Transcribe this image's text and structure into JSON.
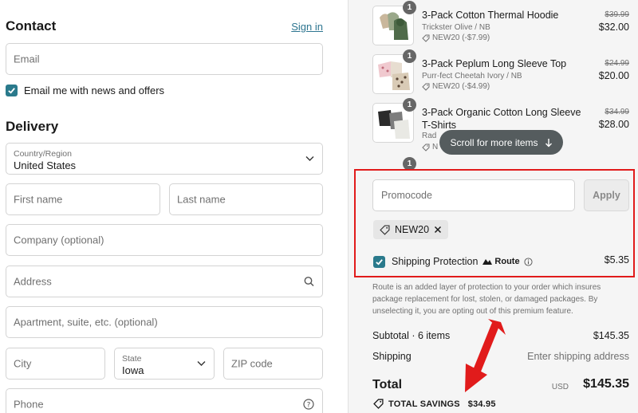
{
  "contact": {
    "title": "Contact",
    "sign_in": "Sign in",
    "email_placeholder": "Email",
    "newsletter_label": "Email me with news and offers"
  },
  "delivery": {
    "title": "Delivery",
    "country_label": "Country/Region",
    "country_value": "United States",
    "first_name_placeholder": "First name",
    "last_name_placeholder": "Last name",
    "company_placeholder": "Company (optional)",
    "address_placeholder": "Address",
    "apartment_placeholder": "Apartment, suite, etc. (optional)",
    "city_placeholder": "City",
    "state_label": "State",
    "state_value": "Iowa",
    "zip_placeholder": "ZIP code",
    "phone_placeholder": "Phone"
  },
  "cart": {
    "items": [
      {
        "quantity": "1",
        "name": "3-Pack Cotton Thermal Hoodie",
        "variant": "Trickster Olive / NB",
        "discount": "NEW20 (-$7.99)",
        "original_price": "$39.99",
        "price": "$32.00"
      },
      {
        "quantity": "1",
        "name": "3-Pack Peplum Long Sleeve Top",
        "variant": "Purr-fect Cheetah Ivory / NB",
        "discount": "NEW20 (-$4.99)",
        "original_price": "$24.99",
        "price": "$20.00"
      },
      {
        "quantity": "1",
        "name": "3-Pack Organic Cotton Long Sleeve T-Shirts",
        "variant": "Rad",
        "discount": "N",
        "original_price": "$34.99",
        "price": "$28.00"
      },
      {
        "quantity": "1"
      }
    ],
    "scroll_hint": "Scroll for more items"
  },
  "promo": {
    "placeholder": "Promocode",
    "apply_label": "Apply",
    "applied_code": "NEW20"
  },
  "shipping_protection": {
    "label": "Shipping Protection",
    "brand": "Route",
    "price": "$5.35",
    "note": "Route is an added layer of protection to your order which insures package replacement for lost, stolen, or damaged packages. By unselecting it, you are opting out of this premium feature."
  },
  "summary": {
    "subtotal_label": "Subtotal · 6 items",
    "subtotal_value": "$145.35",
    "shipping_label": "Shipping",
    "shipping_value": "Enter shipping address",
    "total_label": "Total",
    "currency": "USD",
    "total_value": "$145.35",
    "savings_label": "TOTAL SAVINGS",
    "savings_value": "$34.95"
  },
  "colors": {
    "accent": "#2a7a8c",
    "annotation_red": "#e11b1b",
    "link": "#2d7590"
  }
}
